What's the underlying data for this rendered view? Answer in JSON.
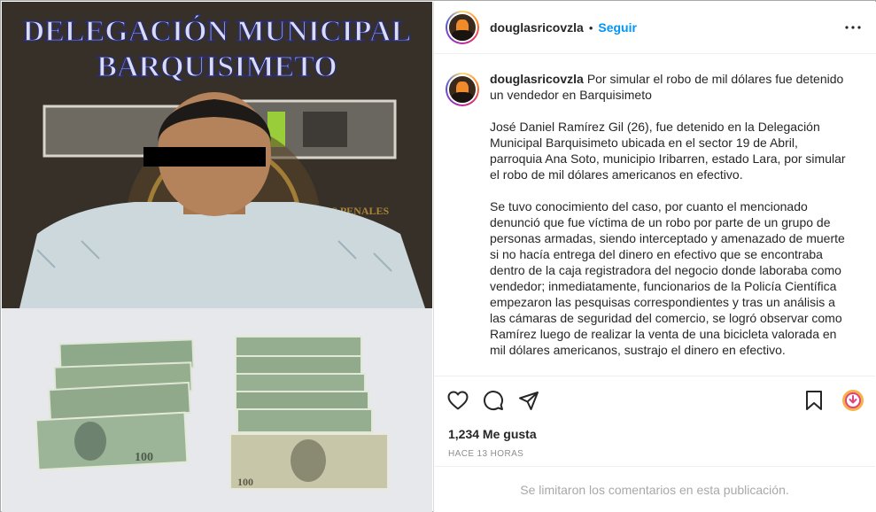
{
  "post": {
    "username": "douglasricovzla",
    "follow_label": "Seguir",
    "separator": "•",
    "media": {
      "banner_line1": "DELEGACIÓN MUNICIPAL",
      "banner_line2": "BARQUISIMETO",
      "wall_text": "FUERZAS PENALES"
    },
    "caption": {
      "headline": "Por simular el robo de mil dólares fue detenido un vendedor en Barquisimeto",
      "paragraph1": "José Daniel Ramírez Gil (26), fue detenido en la Delegación Municipal Barquisimeto ubicada en el sector 19 de Abril, parroquia Ana Soto, municipio Iribarren, estado Lara, por simular el robo de mil dólares americanos en efectivo.",
      "paragraph2": "Se tuvo conocimiento del caso, por cuanto el mencionado denunció que fue víctima de un robo por parte de un grupo de personas armadas, siendo interceptado y amenazado de muerte si no hacía entrega del dinero en efectivo que se encontraba dentro de la caja registradora del negocio donde laboraba como vendedor; inmediatamente, funcionarios de la Policía Científica empezaron las pesquisas correspondientes y tras un análisis a las cámaras de seguridad del comercio, se logró observar como Ramírez luego de realizar la venta de una bicicleta valorada en mil dólares americanos, sustrajo el dinero en efectivo."
    },
    "likes": "1,234 Me gusta",
    "timestamp": "HACE 13 HORAS",
    "comments_disabled": "Se limitaron los comentarios en esta publicación."
  },
  "icons": {
    "more": "more-options-icon",
    "like": "heart-icon",
    "comment": "comment-icon",
    "share": "share-icon",
    "save": "bookmark-icon",
    "extension": "download-extension-icon"
  },
  "colors": {
    "accent": "#0095f6",
    "text": "#262626",
    "muted": "#8e8e8e",
    "banner_text": "#d9dcf2",
    "banner_stroke": "#2a2d6e"
  }
}
